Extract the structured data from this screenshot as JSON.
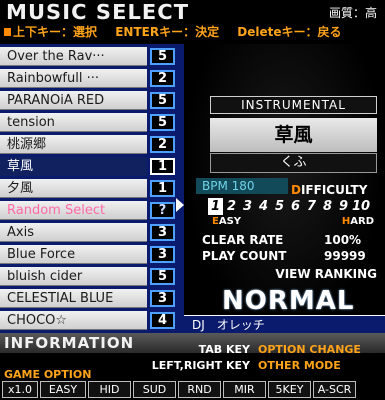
{
  "header": {
    "title": "MUSIC SELECT",
    "quality": "画質：高",
    "controls": {
      "updown": "上下キー：選択",
      "enter": "ENTERキー：決定",
      "delete": "Deleteキー：戻る"
    }
  },
  "songs": [
    {
      "name": "Over the Rav···",
      "level": "5",
      "kind": "normal"
    },
    {
      "name": "Rainbowfull ···",
      "level": "2",
      "kind": "normal"
    },
    {
      "name": "PARANOiA RED",
      "level": "5",
      "kind": "normal"
    },
    {
      "name": "tension",
      "level": "5",
      "kind": "normal"
    },
    {
      "name": "桃源郷",
      "level": "2",
      "kind": "normal"
    },
    {
      "name": "草風",
      "level": "1",
      "kind": "selected"
    },
    {
      "name": "夕風",
      "level": "1",
      "kind": "normal"
    },
    {
      "name": "Random Select",
      "level": "?",
      "kind": "random"
    },
    {
      "name": "Axis",
      "level": "3",
      "kind": "normal"
    },
    {
      "name": "Blue Force",
      "level": "3",
      "kind": "normal"
    },
    {
      "name": "bluish cider",
      "level": "5",
      "kind": "normal"
    },
    {
      "name": "CELESTIAL BLUE",
      "level": "3",
      "kind": "normal"
    },
    {
      "name": "CHOCO☆",
      "level": "4",
      "kind": "normal"
    }
  ],
  "detail": {
    "genre": "INSTRUMENTAL",
    "title": "草風",
    "reading": "くふ",
    "bpm": "BPM 180",
    "difficulty_label_first": "D",
    "difficulty_label_rest": "IFFICULTY",
    "levels": [
      "1",
      "2",
      "3",
      "4",
      "5",
      "6",
      "7",
      "8",
      "9",
      "10"
    ],
    "selected_level": 1,
    "easy_first": "E",
    "easy_rest": "ASY",
    "hard_first": "H",
    "hard_rest": "ARD",
    "clear_rate_label": "CLEAR RATE",
    "clear_rate_value": "100%",
    "play_count_label": "PLAY COUNT",
    "play_count_value": "99999",
    "view_ranking": "VIEW RANKING",
    "mode": "NORMAL",
    "artist": "DJ　オレッチ"
  },
  "info": {
    "label": "INFORMATION",
    "tab_key": "TAB KEY",
    "tab_action": "OPTION CHANGE",
    "lr_key": "LEFT,RIGHT KEY",
    "lr_action": "OTHER MODE",
    "game_option": "GAME OPTION",
    "options": [
      "x1.0",
      "EASY",
      "HID",
      "SUD",
      "RND",
      "MIR",
      "5KEY",
      "A-SCR"
    ]
  },
  "colors": {
    "accent_orange": "#ffa31a",
    "list_bg": "#0a1b6e",
    "level_border": "#4ea0ff",
    "random_pink": "#ff6aa8"
  }
}
